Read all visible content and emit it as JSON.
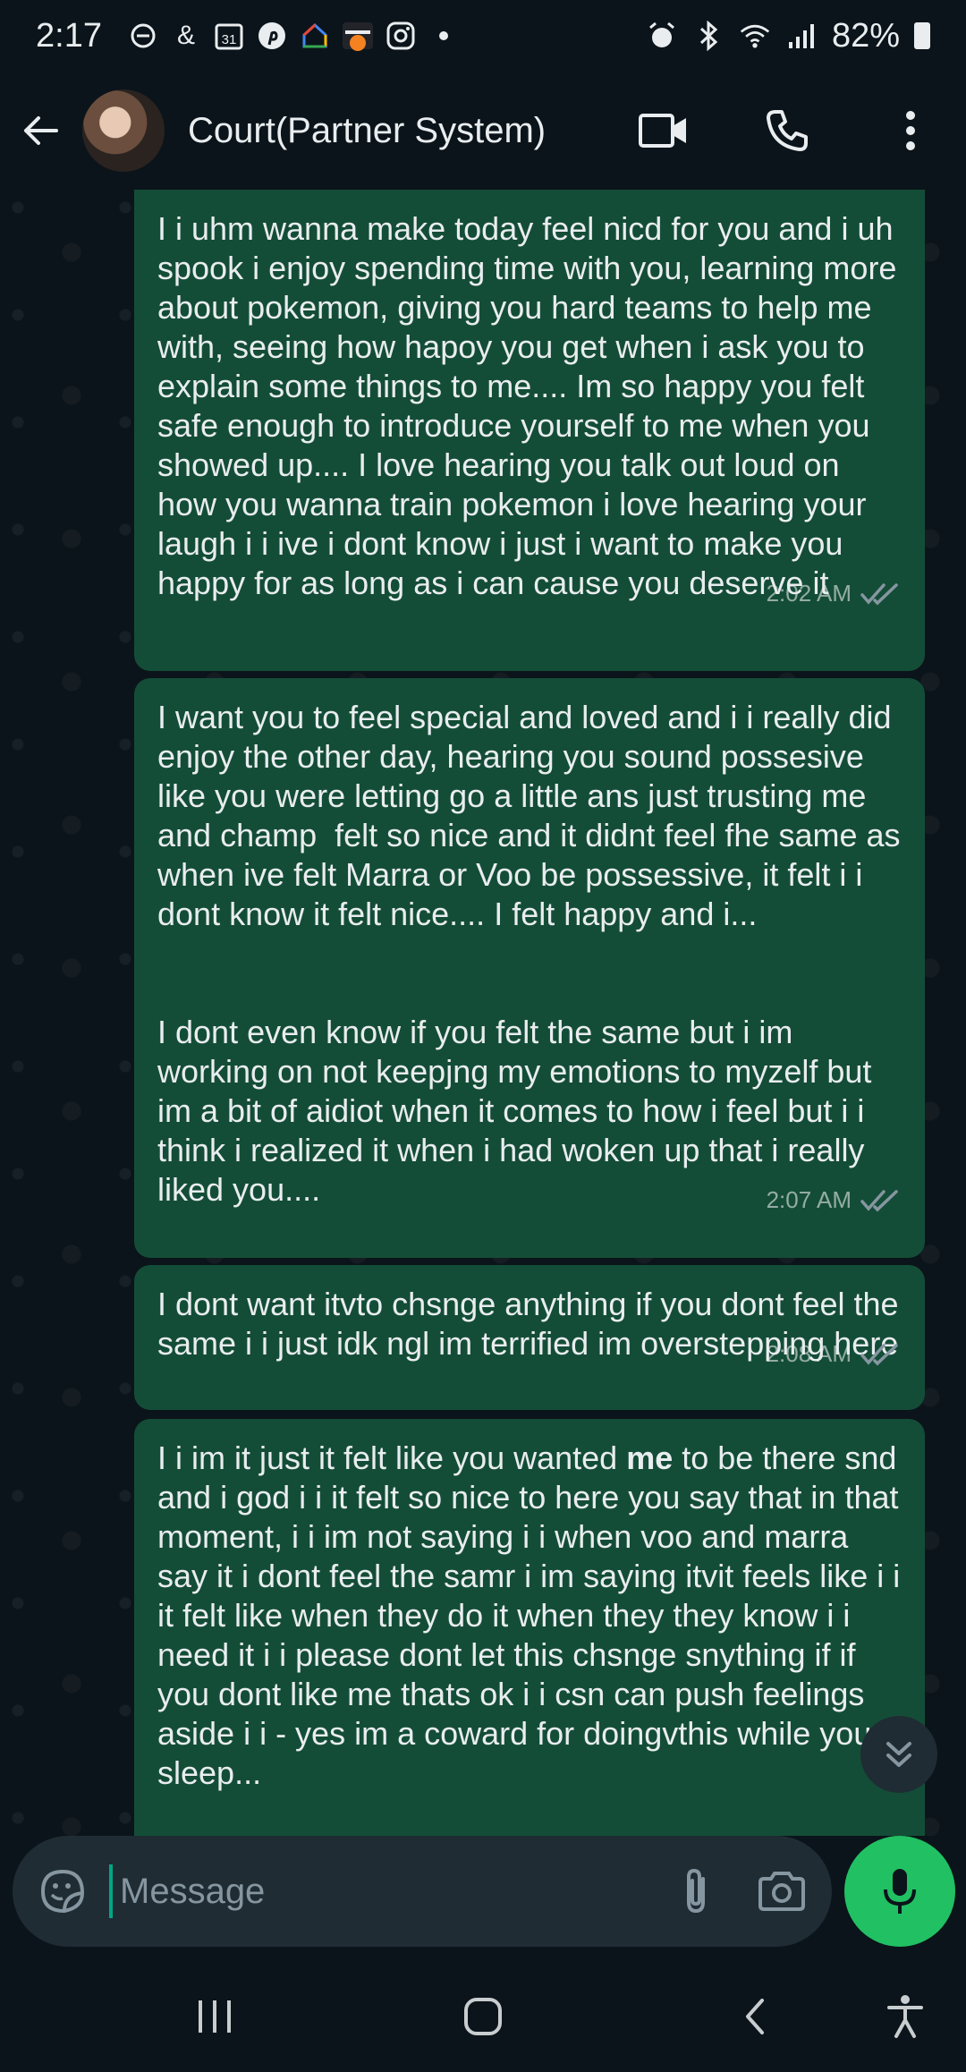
{
  "status_bar": {
    "time": "2:17",
    "notif_icons": [
      "dnd-icon",
      "ampersand-icon",
      "calendar-icon",
      "pinterest-icon",
      "home-icon",
      "discover-icon",
      "instagram-icon",
      "dot-icon"
    ],
    "calendar_day": "31",
    "ampersand": "&",
    "battery": "82%"
  },
  "header": {
    "contact_name": "Court(Partner System)"
  },
  "messages": [
    {
      "text": "I i uhm wanna make today feel nicd for you and i uh spook i enjoy spending time with you, learning more about pokemon, giving you hard teams to help me with, seeing how hapoy you get when i ask you to explain some things to me.... Im so happy you felt safe enough to introduce yourself to me when you showed up.... I love hearing you talk out loud on how you wanna train pokemon i love hearing your laugh i i ive i dont know i just i want to make you happy for as long as i can cause you deserve it",
      "time": "2:02 AM"
    },
    {
      "text": "I want you to feel special and loved and i i really did enjoy the other day, hearing you sound possesive like you were letting go a little ans just trusting me and champ  felt so nice and it didnt feel fhe same as when ive felt Marra or Voo be possessive, it felt i i dont know it felt nice.... I felt happy and i...\n\n\nI dont even know if you felt the same but i im working on not keepjng my emotions to myzelf but im a bit of aidiot when it comes to how i feel but i i think i realized it when i had woken up that i really liked you....",
      "time": "2:07 AM"
    },
    {
      "text": "I dont want itvto chsnge anything if you dont feel the same i i just idk ngl im terrified im overstepping here",
      "time": "2:08 AM"
    },
    {
      "text_before": "I i im it just it felt like you wanted ",
      "text_bold": "me",
      "text_after": " to be there snd and i god i i it felt so nice to here you say that in that moment, i i im not saying i i when voo and marra say it i dont feel the samr i im saying itvit feels like i i it felt like when they do it when they they know i i need it i i please dont let this chsnge snything if if you dont like me thats ok i i csn can push feelings aside i i - yes im a coward for doingvthis while you sleep..."
    }
  ],
  "input": {
    "placeholder": "Message"
  },
  "colors": {
    "background": "#0b141a",
    "bubble_outgoing": "#144d37",
    "accent": "#21c063",
    "ticks": "#8696a0"
  }
}
